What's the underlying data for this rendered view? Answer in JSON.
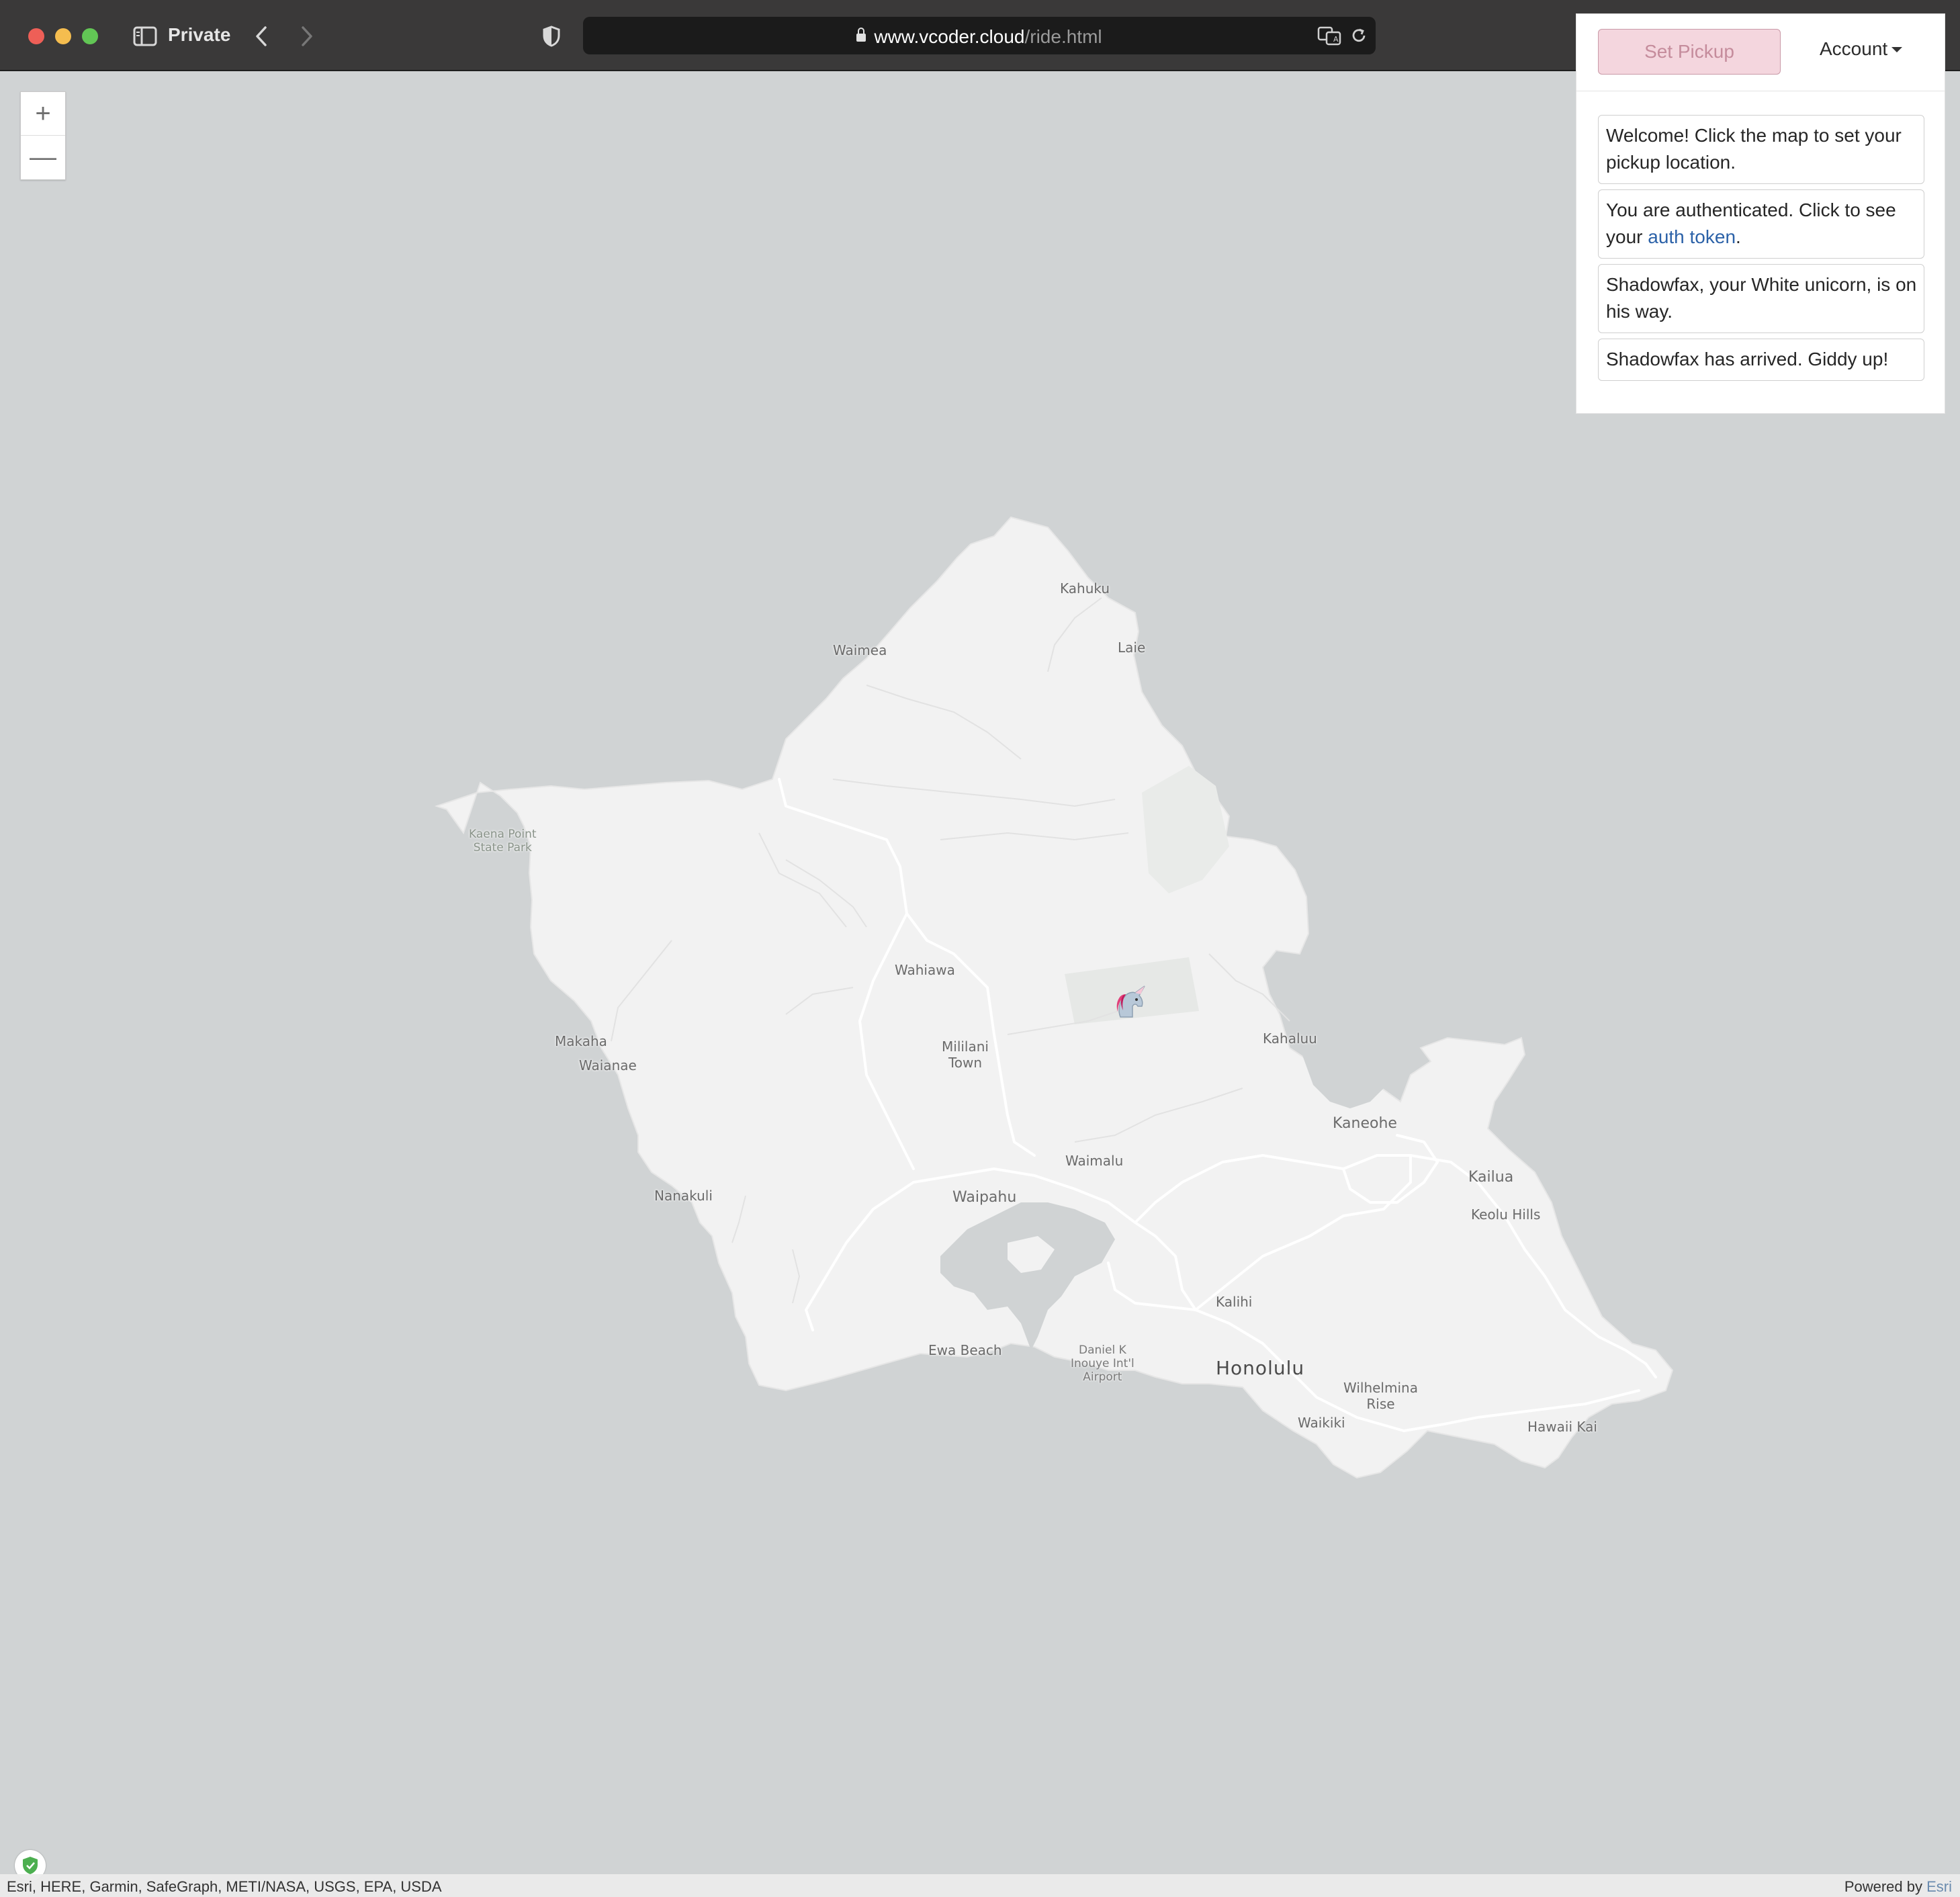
{
  "browser": {
    "private_label": "Private",
    "url_domain": "www.vcoder.cloud",
    "url_path": "/ride.html",
    "icons": [
      "sidebar-icon",
      "back-icon",
      "forward-icon",
      "privacy-shield-icon",
      "lock-icon",
      "translate-icon",
      "reload-icon",
      "download-icon",
      "share-icon",
      "extension-shield-icon",
      "new-tab-icon",
      "tab-overview-icon"
    ]
  },
  "map": {
    "zoom_in": "+",
    "zoom_out": "—",
    "places": {
      "kahuku": "Kahuku",
      "laie": "Laie",
      "waimea": "Waimea",
      "kaena_point_1": "Kaena Point",
      "kaena_point_2": "State Park",
      "wahiawa": "Wahiawa",
      "makaha": "Makaha",
      "waianae": "Waianae",
      "mililani_1": "Mililani",
      "mililani_2": "Town",
      "kahaluu": "Kahaluu",
      "kaneohe": "Kaneohe",
      "waimalu": "Waimalu",
      "kailua": "Kailua",
      "keolu_hills": "Keolu Hills",
      "nanakuli": "Nanakuli",
      "waipahu": "Waipahu",
      "kalihi": "Kalihi",
      "ewa_beach": "Ewa Beach",
      "airport_1": "Daniel K",
      "airport_2": "Inouye Int'l",
      "airport_3": "Airport",
      "honolulu": "Honolulu",
      "wilhelmina_1": "Wilhelmina",
      "wilhelmina_2": "Rise",
      "waikiki": "Waikiki",
      "hawaii_kai": "Hawaii Kai"
    },
    "marker_icon": "unicorn-icon",
    "colors": {
      "water": "#d0d3d4",
      "land": "#f2f2f2",
      "road": "#ffffff"
    }
  },
  "panel": {
    "set_pickup": "Set Pickup",
    "account": "Account",
    "messages": {
      "welcome": "Welcome! Click the map to set your pickup location.",
      "auth_prefix": "You are authenticated. Click to see your ",
      "auth_link": "auth token",
      "auth_suffix": ".",
      "onway": "Shadowfax, your White unicorn, is on his way.",
      "arrived": "Shadowfax has arrived. Giddy up!"
    },
    "colors": {
      "pickup_bg": "#f4d6de",
      "link": "#2c62a8"
    }
  },
  "attribution": {
    "sources": "Esri, HERE, Garmin, SafeGraph, METI/NASA, USGS, EPA, USDA",
    "powered_by": "Powered by ",
    "esri": "Esri"
  }
}
